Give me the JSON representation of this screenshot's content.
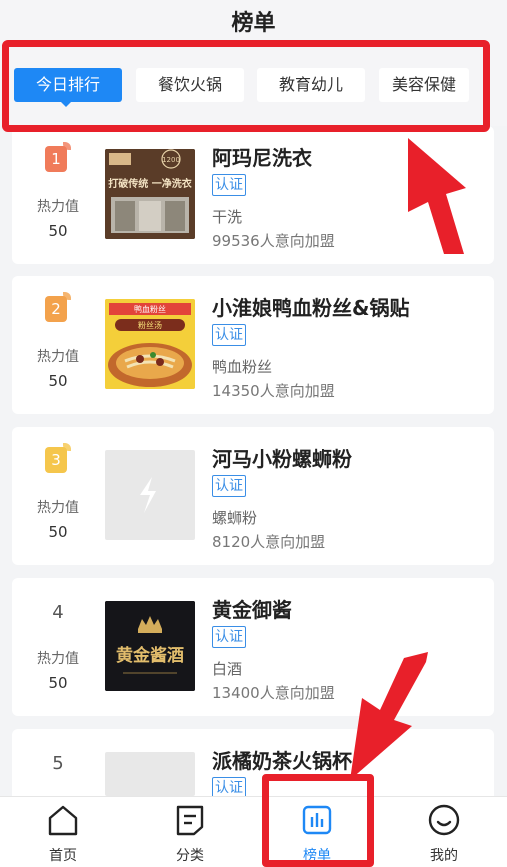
{
  "header": {
    "title": "榜单"
  },
  "tabs": [
    {
      "label": "今日排行",
      "active": true
    },
    {
      "label": "餐饮火锅",
      "active": false
    },
    {
      "label": "教育幼儿",
      "active": false
    },
    {
      "label": "美容保健",
      "active": false
    }
  ],
  "list": {
    "heat_label": "热力值",
    "cert_label": "认证",
    "items": [
      {
        "rank": "1",
        "heat": "50",
        "name": "阿玛尼洗衣",
        "category": "干洗",
        "joins": "99536人意向加盟",
        "thumb_text": "打破传统 一净洗衣",
        "thumb_sub": "1200"
      },
      {
        "rank": "2",
        "heat": "50",
        "name": "小淮娘鸭血粉丝&锅贴",
        "category": "鸭血粉丝",
        "joins": "14350人意向加盟",
        "thumb_text": "鸭血粉丝",
        "thumb_sub": "粉丝汤"
      },
      {
        "rank": "3",
        "heat": "50",
        "name": "河马小粉螺蛳粉",
        "category": "螺蛳粉",
        "joins": "8120人意向加盟"
      },
      {
        "rank": "4",
        "heat": "50",
        "name": "黄金御酱",
        "category": "白酒",
        "joins": "13400人意向加盟",
        "thumb_text": "黄金酱酒"
      },
      {
        "rank": "5",
        "heat": "",
        "name": "派橘奶茶火锅杯",
        "category": "",
        "joins": ""
      }
    ]
  },
  "bottom_nav": [
    {
      "label": "首页",
      "icon": "home-icon",
      "active": false
    },
    {
      "label": "分类",
      "icon": "category-icon",
      "active": false
    },
    {
      "label": "榜单",
      "icon": "chart-icon",
      "active": true
    },
    {
      "label": "我的",
      "icon": "profile-icon",
      "active": false
    }
  ],
  "colors": {
    "accent": "#1e88f5",
    "highlight": "#e8202a",
    "rank1": "#f07b5a",
    "rank2": "#f3a24c",
    "rank3": "#f5c64c"
  }
}
